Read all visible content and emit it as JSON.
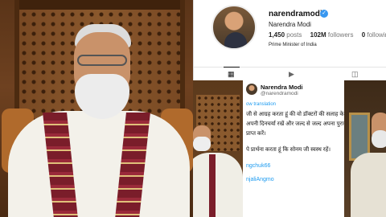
{
  "profile": {
    "username": "narendramodi",
    "full_name": "Narendra Modi",
    "posts_count": "1,450",
    "posts_label": "posts",
    "followers_count": "102M",
    "followers_label": "followers",
    "following_count": "0",
    "following_label": "following",
    "bio": "Prime Minister of India",
    "verified_color": "#3897f0"
  },
  "tabs": [
    {
      "icon": "grid-icon",
      "glyph": "▦",
      "active": true
    },
    {
      "icon": "reels-icon",
      "glyph": "▶",
      "active": false
    },
    {
      "icon": "tagged-icon",
      "glyph": "◫",
      "active": false
    }
  ],
  "tweet": {
    "name": "Narendra Modi",
    "handle": "@narendramodi",
    "translation_label": "ow translation",
    "lines": [
      "जी से आग्रह करता हूं की वो डॉक्टरों की सलाह के",
      "अपनी दिनचर्या रखें और जल्द से जल्द अपना पुराना",
      "प्राप्त करें।",
      "पे प्रार्थना करता हूं कि सोनम जी स्वस्थ रहें।"
    ],
    "links": [
      "ngchuk66",
      "njaliAngmo"
    ],
    "link_color": "#1d9bf0"
  }
}
